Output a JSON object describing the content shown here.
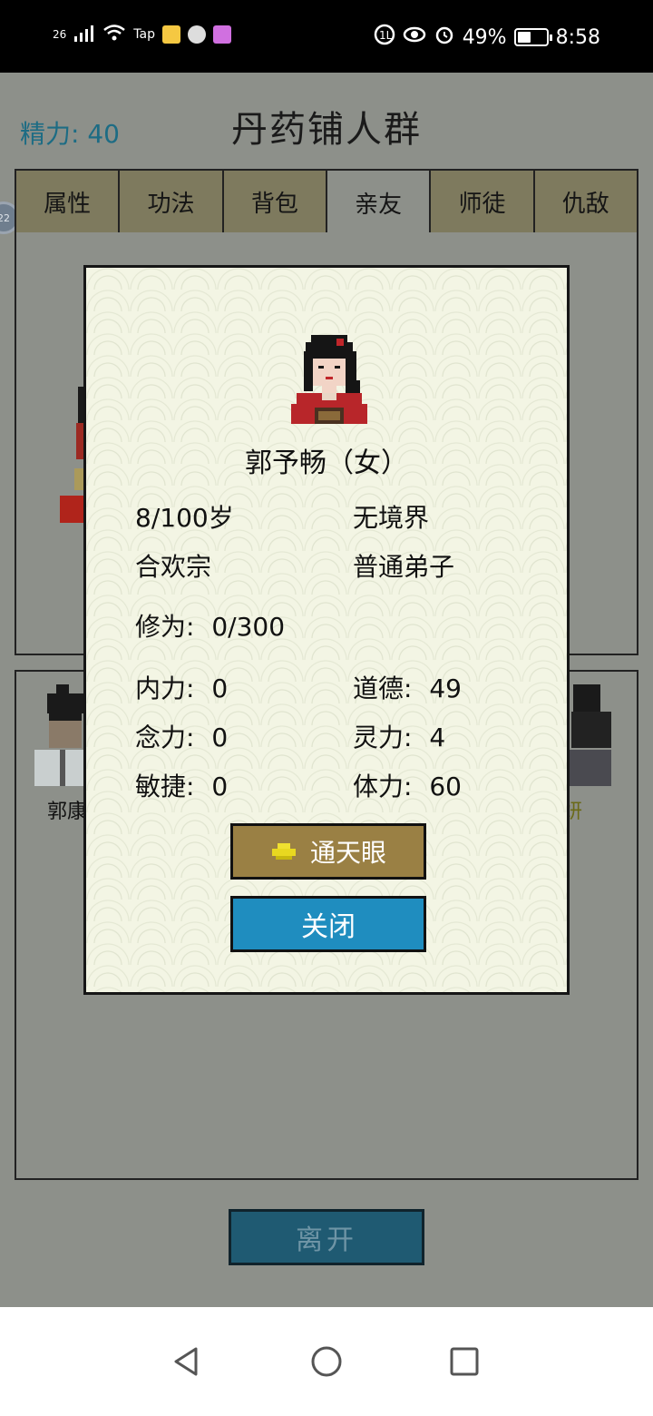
{
  "status_bar": {
    "network": "26",
    "tap_label": "Tap",
    "battery": "49%",
    "time": "8:58"
  },
  "header": {
    "energy_label": "精力:",
    "energy_value": "40",
    "title": "丹药铺人群"
  },
  "tabs": [
    {
      "label": "属性"
    },
    {
      "label": "功法"
    },
    {
      "label": "背包"
    },
    {
      "label": "亲友"
    },
    {
      "label": "师徒"
    },
    {
      "label": "仇敌"
    }
  ],
  "side_bubble": "22",
  "background_names": {
    "left": "郭康",
    "right": "妍"
  },
  "leave_button": "离开",
  "dialog": {
    "name": "郭予畅（女）",
    "age": "8/100岁",
    "realm": "无境界",
    "sect": "合欢宗",
    "rank": "普通弟子",
    "cultivation_label": "修为:",
    "cultivation_value": "0/300",
    "stats": [
      {
        "label": "内力:",
        "value": "0"
      },
      {
        "label": "道德:",
        "value": "49"
      },
      {
        "label": "念力:",
        "value": "0"
      },
      {
        "label": "灵力:",
        "value": "4"
      },
      {
        "label": "敏捷:",
        "value": "0"
      },
      {
        "label": "体力:",
        "value": "60"
      }
    ],
    "eye_button": "通天眼",
    "close_button": "关闭"
  },
  "icons": {
    "back": "back-triangle-icon",
    "home": "home-circle-icon",
    "recent": "recent-square-icon"
  }
}
